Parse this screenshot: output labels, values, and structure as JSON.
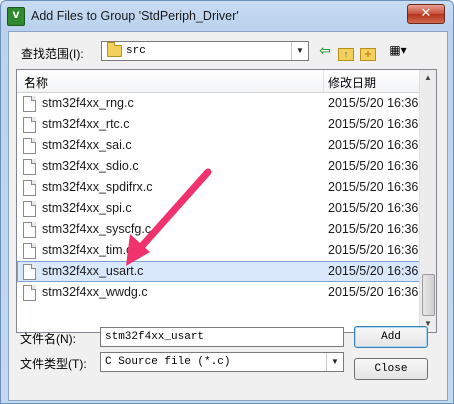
{
  "window": {
    "title": "Add Files to Group 'StdPeriph_Driver'",
    "close_glyph": "✕",
    "app_icon_text": "V"
  },
  "lookin": {
    "label": "查找范围(I):",
    "value": "src"
  },
  "toolbar": {
    "back_glyph": "⇦",
    "up_glyph": "↑",
    "new_folder_glyph": "✚",
    "view_glyph": "▦▾"
  },
  "list": {
    "columns": {
      "name": "名称",
      "date": "修改日期"
    },
    "files": [
      {
        "name": "stm32f4xx_rng.c",
        "date": "2015/5/20 16:36"
      },
      {
        "name": "stm32f4xx_rtc.c",
        "date": "2015/5/20 16:36"
      },
      {
        "name": "stm32f4xx_sai.c",
        "date": "2015/5/20 16:36"
      },
      {
        "name": "stm32f4xx_sdio.c",
        "date": "2015/5/20 16:36"
      },
      {
        "name": "stm32f4xx_spdifrx.c",
        "date": "2015/5/20 16:36"
      },
      {
        "name": "stm32f4xx_spi.c",
        "date": "2015/5/20 16:36"
      },
      {
        "name": "stm32f4xx_syscfg.c",
        "date": "2015/5/20 16:36"
      },
      {
        "name": "stm32f4xx_tim.c",
        "date": "2015/5/20 16:36"
      },
      {
        "name": "stm32f4xx_usart.c",
        "date": "2015/5/20 16:36",
        "selected": true
      },
      {
        "name": "stm32f4xx_wwdg.c",
        "date": "2015/5/20 16:36"
      }
    ]
  },
  "filename": {
    "label": "文件名(N):",
    "value": "stm32f4xx_usart"
  },
  "filetype": {
    "label": "文件类型(T):",
    "value": "C Source file (*.c)"
  },
  "buttons": {
    "add": "Add",
    "close": "Close"
  },
  "annotation": {
    "color": "#f0336c"
  }
}
